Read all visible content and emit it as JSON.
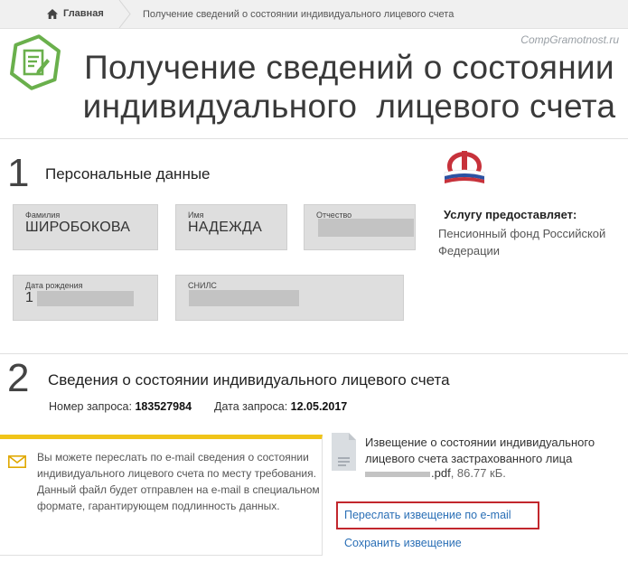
{
  "breadcrumb": {
    "home_label": "Главная",
    "current_label": "Получение сведений о состоянии индивидуального лицевого счета"
  },
  "watermark": "CompGramotnost.ru",
  "header": {
    "title_line1": "Получение сведений о состоянии",
    "title_line2": "индивидуального  лицевого счета",
    "icon": "document-edit-icon"
  },
  "step1": {
    "number": "1",
    "title": "Персональные данные",
    "fields": {
      "last_name": {
        "label": "Фамилия",
        "value": "ШИРОБОКОВА"
      },
      "first_name": {
        "label": "Имя",
        "value": "НАДЕЖДА"
      },
      "patronymic": {
        "label": "Отчество",
        "value": ""
      },
      "birth_date": {
        "label": "Дата рождения",
        "value": "1"
      },
      "snils": {
        "label": "СНИЛС",
        "value": ""
      }
    }
  },
  "provider": {
    "label": "Услугу предоставляет:",
    "name": "Пенсионный фонд Российской Федерации",
    "logo": "pfr-logo"
  },
  "step2": {
    "number": "2",
    "title": "Сведения о состоянии индивидуального лицевого счета",
    "request_number_label": "Номер запроса:",
    "request_number": "183527984",
    "request_date_label": "Дата запроса:",
    "request_date": "12.05.2017"
  },
  "info": {
    "text": "Вы можете переслать по e-mail сведения о состоянии индивидуального лицевого счета по месту требования. Данный файл будет отправлен на e-mail в специальном формате, гарантирующем подлинность данных.",
    "icon": "envelope-icon"
  },
  "file": {
    "title": "Извещение о состоянии индивидуального лицевого счета застрахованного лица",
    "extension": ".pdf",
    "size": ", 86.77 кБ.",
    "icon": "document-icon"
  },
  "actions": {
    "forward_label": "Переслать извещение по e-mail",
    "save_label": "Сохранить извещение"
  },
  "colors": {
    "accent_green": "#6ab04c",
    "info_border": "#f0c419",
    "link": "#2a6fb6",
    "highlight_red": "#c2272d"
  }
}
